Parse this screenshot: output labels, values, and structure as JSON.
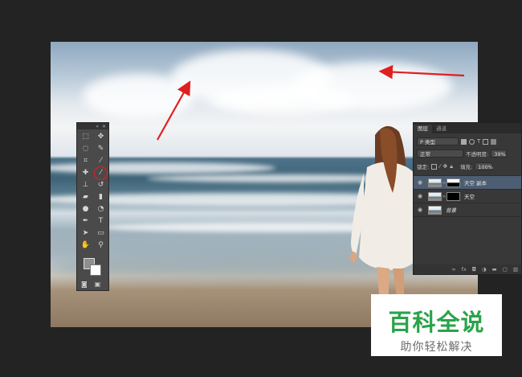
{
  "toolbox": {
    "header_icons": [
      "collapse-icon",
      "close-icon"
    ],
    "tools": [
      {
        "name": "marquee-tool",
        "glyph": "⬚"
      },
      {
        "name": "move-tool",
        "glyph": "✥"
      },
      {
        "name": "lasso-tool",
        "glyph": "◌"
      },
      {
        "name": "quick-select-tool",
        "glyph": "✎"
      },
      {
        "name": "crop-tool",
        "glyph": "⌗"
      },
      {
        "name": "eyedropper-tool",
        "glyph": "⁄"
      },
      {
        "name": "healing-brush-tool",
        "glyph": "✚"
      },
      {
        "name": "brush-tool",
        "glyph": "⁄",
        "active": true
      },
      {
        "name": "clone-stamp-tool",
        "glyph": "⊥"
      },
      {
        "name": "history-brush-tool",
        "glyph": "↺"
      },
      {
        "name": "eraser-tool",
        "glyph": "▰"
      },
      {
        "name": "gradient-tool",
        "glyph": "▮"
      },
      {
        "name": "blur-tool",
        "glyph": "●"
      },
      {
        "name": "dodge-tool",
        "glyph": "◔"
      },
      {
        "name": "pen-tool",
        "glyph": "✒"
      },
      {
        "name": "type-tool",
        "glyph": "T"
      },
      {
        "name": "path-select-tool",
        "glyph": "➤"
      },
      {
        "name": "rectangle-tool",
        "glyph": "▭"
      },
      {
        "name": "hand-tool",
        "glyph": "✋"
      },
      {
        "name": "zoom-tool",
        "glyph": "⚲"
      }
    ],
    "foreground_color": "#8f8f8f",
    "background_color": "#ffffff",
    "bottom_icons": [
      "quick-mask-icon",
      "screen-mode-icon"
    ]
  },
  "layers_panel": {
    "tabs": [
      "图层",
      "通道"
    ],
    "filter_kind": "P 类型",
    "blend_mode": "正常",
    "opacity_label": "不透明度:",
    "opacity_value": "39%",
    "lock_label": "锁定:",
    "fill_label": "填充:",
    "fill_value": "100%",
    "layers": [
      {
        "name": "天空 副本",
        "selected": true,
        "mask": true
      },
      {
        "name": "天空",
        "selected": false,
        "mask": true
      },
      {
        "name": "背景",
        "selected": false,
        "mask": false
      }
    ],
    "footer_icons": [
      "link-icon",
      "fx-icon",
      "mask-icon",
      "adjustment-icon",
      "group-icon",
      "new-layer-icon",
      "trash-icon"
    ]
  },
  "watermark": {
    "title": "百科全说",
    "subtitle": "助你轻松解决",
    "title_color": "#2aa34a"
  },
  "annotations": {
    "arrow_color": "#e02020"
  }
}
